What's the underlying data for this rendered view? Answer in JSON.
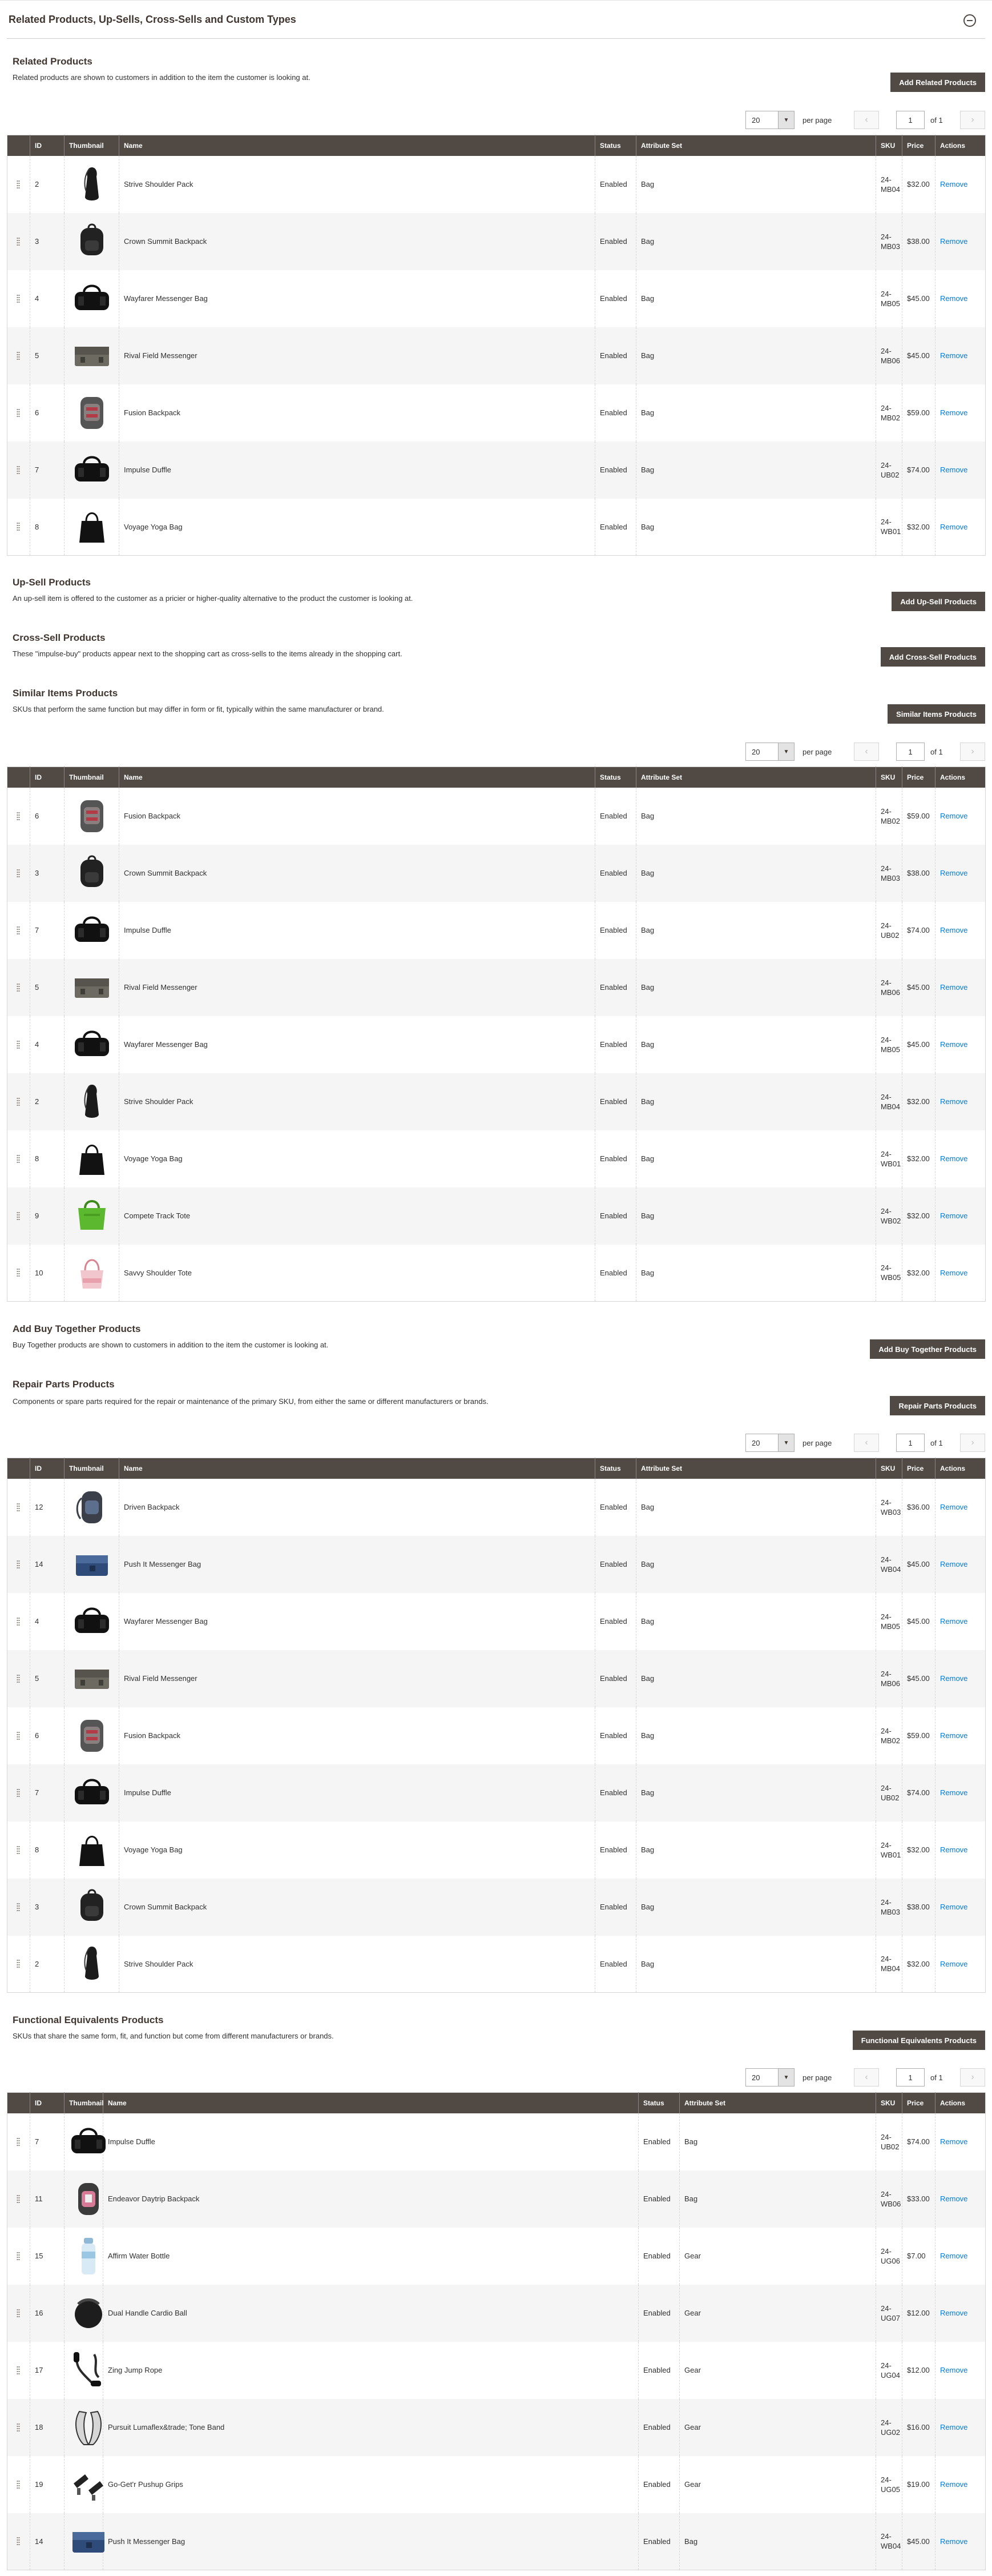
{
  "panel": {
    "title": "Related Products, Up-Sells, Cross-Sells and Custom Types"
  },
  "columns": {
    "id": "ID",
    "thumbnail": "Thumbnail",
    "name": "Name",
    "status": "Status",
    "attribute_set": "Attribute Set",
    "sku": "SKU",
    "price": "Price",
    "actions": "Actions"
  },
  "pager": {
    "per_page_value": "20",
    "per_page_label": "per page",
    "page": "1",
    "of_label": "of 1"
  },
  "remove_label": "Remove",
  "sections": [
    {
      "key": "related",
      "title": "Related Products",
      "description": "Related products are shown to customers in addition to the item the customer is looking at.",
      "button": "Add Related Products",
      "rows": [
        {
          "id": "2",
          "name": "Strive Shoulder Pack",
          "status": "Enabled",
          "attr": "Bag",
          "sku": "24-MB04",
          "price": "$32.00",
          "thumb": "shoulder"
        },
        {
          "id": "3",
          "name": "Crown Summit Backpack",
          "status": "Enabled",
          "attr": "Bag",
          "sku": "24-MB03",
          "price": "$38.00",
          "thumb": "backpack-black"
        },
        {
          "id": "4",
          "name": "Wayfarer Messenger Bag",
          "status": "Enabled",
          "attr": "Bag",
          "sku": "24-MB05",
          "price": "$45.00",
          "thumb": "duffle"
        },
        {
          "id": "5",
          "name": "Rival Field Messenger",
          "status": "Enabled",
          "attr": "Bag",
          "sku": "24-MB06",
          "price": "$45.00",
          "thumb": "messenger-gray"
        },
        {
          "id": "6",
          "name": "Fusion Backpack",
          "status": "Enabled",
          "attr": "Bag",
          "sku": "24-MB02",
          "price": "$59.00",
          "thumb": "backpack-red"
        },
        {
          "id": "7",
          "name": "Impulse Duffle",
          "status": "Enabled",
          "attr": "Bag",
          "sku": "24-UB02",
          "price": "$74.00",
          "thumb": "duffle"
        },
        {
          "id": "8",
          "name": "Voyage Yoga Bag",
          "status": "Enabled",
          "attr": "Bag",
          "sku": "24-WB01",
          "price": "$32.00",
          "thumb": "tote-black"
        }
      ]
    },
    {
      "key": "upsell",
      "title": "Up-Sell Products",
      "description": "An up-sell item is offered to the customer as a pricier or higher-quality alternative to the product the customer is looking at.",
      "button": "Add Up-Sell Products",
      "rows": []
    },
    {
      "key": "crosssell",
      "title": "Cross-Sell Products",
      "description": "These \"impulse-buy\" products appear next to the shopping cart as cross-sells to the items already in the shopping cart.",
      "button": "Add Cross-Sell Products",
      "rows": []
    },
    {
      "key": "similar",
      "title": "Similar Items Products",
      "description": "SKUs that perform the same function but may differ in form or fit, typically within the same manufacturer or brand.",
      "button": "Similar Items Products",
      "rows": [
        {
          "id": "6",
          "name": "Fusion Backpack",
          "status": "Enabled",
          "attr": "Bag",
          "sku": "24-MB02",
          "price": "$59.00",
          "thumb": "backpack-red"
        },
        {
          "id": "3",
          "name": "Crown Summit Backpack",
          "status": "Enabled",
          "attr": "Bag",
          "sku": "24-MB03",
          "price": "$38.00",
          "thumb": "backpack-black"
        },
        {
          "id": "7",
          "name": "Impulse Duffle",
          "status": "Enabled",
          "attr": "Bag",
          "sku": "24-UB02",
          "price": "$74.00",
          "thumb": "duffle"
        },
        {
          "id": "5",
          "name": "Rival Field Messenger",
          "status": "Enabled",
          "attr": "Bag",
          "sku": "24-MB06",
          "price": "$45.00",
          "thumb": "messenger-gray"
        },
        {
          "id": "4",
          "name": "Wayfarer Messenger Bag",
          "status": "Enabled",
          "attr": "Bag",
          "sku": "24-MB05",
          "price": "$45.00",
          "thumb": "duffle"
        },
        {
          "id": "2",
          "name": "Strive Shoulder Pack",
          "status": "Enabled",
          "attr": "Bag",
          "sku": "24-MB04",
          "price": "$32.00",
          "thumb": "shoulder"
        },
        {
          "id": "8",
          "name": "Voyage Yoga Bag",
          "status": "Enabled",
          "attr": "Bag",
          "sku": "24-WB01",
          "price": "$32.00",
          "thumb": "tote-black"
        },
        {
          "id": "9",
          "name": "Compete Track Tote",
          "status": "Enabled",
          "attr": "Bag",
          "sku": "24-WB02",
          "price": "$32.00",
          "thumb": "tote-green"
        },
        {
          "id": "10",
          "name": "Savvy Shoulder Tote",
          "status": "Enabled",
          "attr": "Bag",
          "sku": "24-WB05",
          "price": "$32.00",
          "thumb": "tote-pink"
        }
      ]
    },
    {
      "key": "buytogether",
      "title": "Add Buy Together Products",
      "description": "Buy Together products are shown to customers in addition to the item the customer is looking at.",
      "button": "Add Buy Together Products",
      "rows": []
    },
    {
      "key": "repair",
      "title": "Repair Parts Products",
      "description": "Components or spare parts required for the repair or maintenance of the primary SKU, from either the same or different manufacturers or brands.",
      "button": "Repair Parts Products",
      "rows": [
        {
          "id": "12",
          "name": "Driven Backpack",
          "status": "Enabled",
          "attr": "Bag",
          "sku": "24-WB03",
          "price": "$36.00",
          "thumb": "backpack-blue"
        },
        {
          "id": "14",
          "name": "Push It Messenger Bag",
          "status": "Enabled",
          "attr": "Bag",
          "sku": "24-WB04",
          "price": "$45.00",
          "thumb": "messenger-blue"
        },
        {
          "id": "4",
          "name": "Wayfarer Messenger Bag",
          "status": "Enabled",
          "attr": "Bag",
          "sku": "24-MB05",
          "price": "$45.00",
          "thumb": "duffle"
        },
        {
          "id": "5",
          "name": "Rival Field Messenger",
          "status": "Enabled",
          "attr": "Bag",
          "sku": "24-MB06",
          "price": "$45.00",
          "thumb": "messenger-gray"
        },
        {
          "id": "6",
          "name": "Fusion Backpack",
          "status": "Enabled",
          "attr": "Bag",
          "sku": "24-MB02",
          "price": "$59.00",
          "thumb": "backpack-red"
        },
        {
          "id": "7",
          "name": "Impulse Duffle",
          "status": "Enabled",
          "attr": "Bag",
          "sku": "24-UB02",
          "price": "$74.00",
          "thumb": "duffle"
        },
        {
          "id": "8",
          "name": "Voyage Yoga Bag",
          "status": "Enabled",
          "attr": "Bag",
          "sku": "24-WB01",
          "price": "$32.00",
          "thumb": "tote-black"
        },
        {
          "id": "3",
          "name": "Crown Summit Backpack",
          "status": "Enabled",
          "attr": "Bag",
          "sku": "24-MB03",
          "price": "$38.00",
          "thumb": "backpack-black"
        },
        {
          "id": "2",
          "name": "Strive Shoulder Pack",
          "status": "Enabled",
          "attr": "Bag",
          "sku": "24-MB04",
          "price": "$32.00",
          "thumb": "shoulder"
        }
      ]
    },
    {
      "key": "functional",
      "title": "Functional Equivalents Products",
      "description": "SKUs that share the same form, fit, and function but come from different manufacturers or brands.",
      "button": "Functional Equivalents Products",
      "rows": [
        {
          "id": "7",
          "name": "Impulse Duffle",
          "status": "Enabled",
          "attr": "Bag",
          "sku": "24-UB02",
          "price": "$74.00",
          "thumb": "duffle"
        },
        {
          "id": "11",
          "name": "Endeavor Daytrip Backpack",
          "status": "Enabled",
          "attr": "Bag",
          "sku": "24-WB06",
          "price": "$33.00",
          "thumb": "backpack-pink"
        },
        {
          "id": "15",
          "name": "Affirm Water Bottle",
          "status": "Enabled",
          "attr": "Gear",
          "sku": "24-UG06",
          "price": "$7.00",
          "thumb": "bottle"
        },
        {
          "id": "16",
          "name": "Dual Handle Cardio Ball",
          "status": "Enabled",
          "attr": "Gear",
          "sku": "24-UG07",
          "price": "$12.00",
          "thumb": "ball"
        },
        {
          "id": "17",
          "name": "Zing Jump Rope",
          "status": "Enabled",
          "attr": "Gear",
          "sku": "24-UG04",
          "price": "$12.00",
          "thumb": "rope"
        },
        {
          "id": "18",
          "name": "Pursuit Lumaflex&trade; Tone Band",
          "status": "Enabled",
          "attr": "Gear",
          "sku": "24-UG02",
          "price": "$16.00",
          "thumb": "band"
        },
        {
          "id": "19",
          "name": "Go-Get'r Pushup Grips",
          "status": "Enabled",
          "attr": "Gear",
          "sku": "24-UG05",
          "price": "$19.00",
          "thumb": "grips"
        },
        {
          "id": "14",
          "name": "Push It Messenger Bag",
          "status": "Enabled",
          "attr": "Bag",
          "sku": "24-WB04",
          "price": "$45.00",
          "thumb": "messenger-blue"
        }
      ]
    }
  ]
}
